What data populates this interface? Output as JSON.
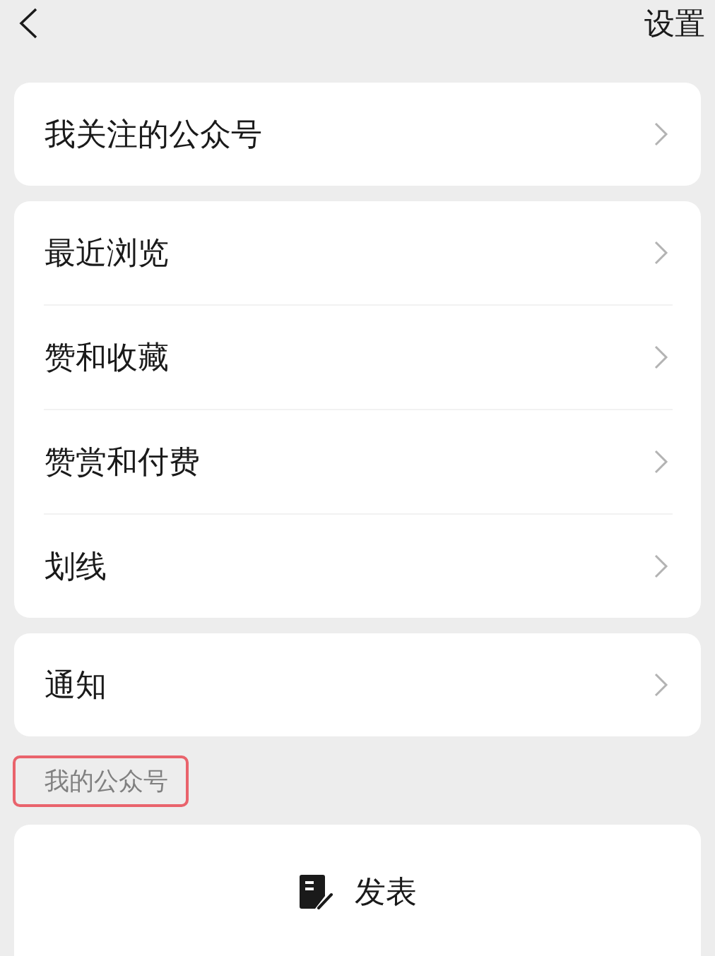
{
  "top_bar": {
    "title": "设置"
  },
  "groups": [
    {
      "items": [
        {
          "label": "我关注的公众号"
        }
      ]
    },
    {
      "items": [
        {
          "label": "最近浏览"
        },
        {
          "label": "赞和收藏"
        },
        {
          "label": "赞赏和付费"
        },
        {
          "label": "划线"
        }
      ]
    },
    {
      "items": [
        {
          "label": "通知"
        }
      ]
    }
  ],
  "section_label": {
    "text": "我的公众号",
    "highlighted": true
  },
  "publish_card": {
    "button": {
      "label": "发表"
    }
  }
}
